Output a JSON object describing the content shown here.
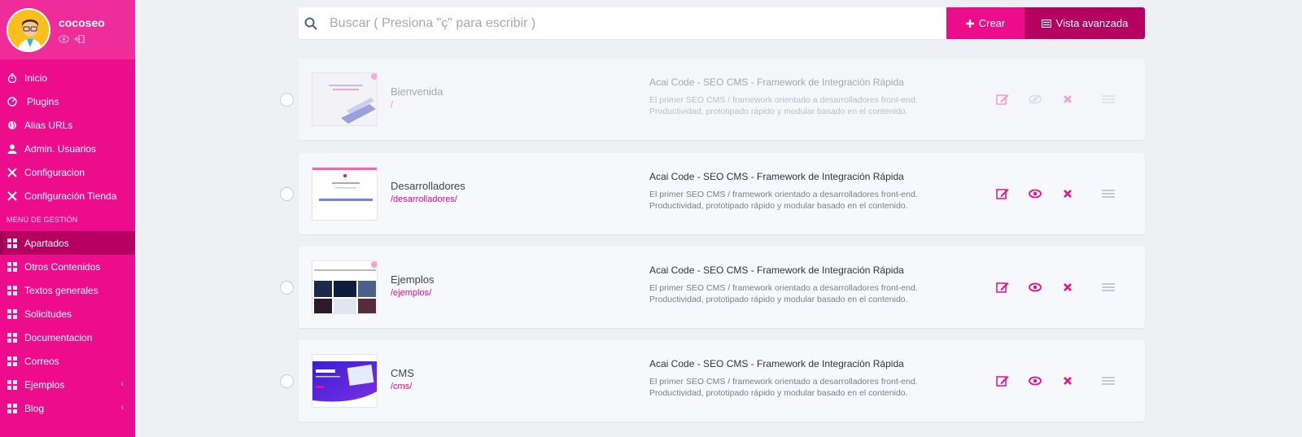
{
  "user": {
    "name": "cocoseo"
  },
  "sidebar": {
    "items": [
      {
        "label": "Inicio",
        "icon": "stopwatch-icon"
      },
      {
        "label": "Plugins",
        "icon": "dashboard-icon"
      },
      {
        "label": "Alias URLs",
        "icon": "globe-icon"
      },
      {
        "label": "Admin. Usuarios",
        "icon": "user-icon"
      },
      {
        "label": "Configuracion",
        "icon": "tools-icon"
      },
      {
        "label": "Configuración Tienda",
        "icon": "tools-icon"
      }
    ],
    "section_header": "MENÚ DE GESTIÓN",
    "management": [
      {
        "label": "Apartados",
        "active": true
      },
      {
        "label": "Otros Contenidos"
      },
      {
        "label": "Textos generales"
      },
      {
        "label": "Solicitudes"
      },
      {
        "label": "Documentacion"
      },
      {
        "label": "Correos"
      },
      {
        "label": "Ejemplos",
        "has_submenu": true
      },
      {
        "label": "Blog",
        "has_submenu": true
      }
    ],
    "chevron": "‹"
  },
  "search": {
    "placeholder": "Buscar ( Presiona \"ç\" para escribir )"
  },
  "toolbar": {
    "create_label": "Crear",
    "advanced_label": "Vista avanzada"
  },
  "colors": {
    "primary": "#ec0c8c",
    "dark": "#b5005f",
    "background": "#eef0f4"
  },
  "pages": [
    {
      "title": "Bienvenida",
      "slug": "/",
      "meta_title": "Acai Code - SEO CMS - Framework de Integración Rápida",
      "meta_desc_1": "El primer SEO CMS / framework orientado a desarrolladores front-end.",
      "meta_desc_2": "Productividad, prototipado rápido y modular basado en el contenido.",
      "visible": false
    },
    {
      "title": "Desarrolladores",
      "slug": "/desarrolladores/",
      "meta_title": "Acai Code - SEO CMS - Framework de Integración Rápida",
      "meta_desc_1": "El primer SEO CMS / framework orientado a desarrolladores front-end.",
      "meta_desc_2": "Productividad, prototipado rápido y modular basado en el contenido.",
      "visible": true
    },
    {
      "title": "Ejemplos",
      "slug": "/ejemplos/",
      "meta_title": "Acai Code - SEO CMS - Framework de Integración Rápida",
      "meta_desc_1": "El primer SEO CMS / framework orientado a desarrolladores front-end.",
      "meta_desc_2": "Productividad, prototipado rápido y modular basado en el contenido.",
      "visible": true
    },
    {
      "title": "CMS",
      "slug": "/cms/",
      "meta_title": "Acai Code - SEO CMS - Framework de Integración Rápida",
      "meta_desc_1": "El primer SEO CMS / framework orientado a desarrolladores front-end.",
      "meta_desc_2": "Productividad, prototipado rápido y modular basado en el contenido.",
      "visible": true
    }
  ]
}
